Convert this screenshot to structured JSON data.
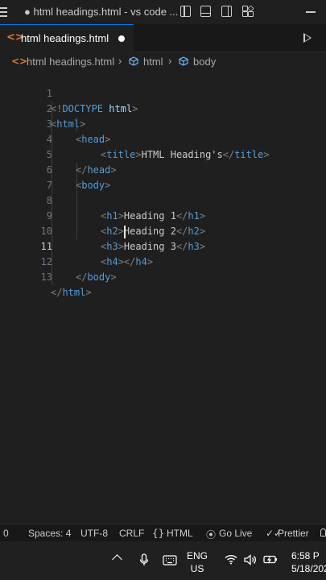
{
  "window": {
    "title": "● html headings.html - vs code ..."
  },
  "tab": {
    "label": "html headings.html",
    "modified": true,
    "icon": "html-file-icon"
  },
  "breadcrumb": {
    "file": "html headings.html",
    "items": [
      "html",
      "body"
    ]
  },
  "editor": {
    "active_line": 11,
    "lines": [
      {
        "n": "1"
      },
      {
        "n": "2"
      },
      {
        "n": "3"
      },
      {
        "n": "4"
      },
      {
        "n": "5"
      },
      {
        "n": "6"
      },
      {
        "n": "7"
      },
      {
        "n": "8"
      },
      {
        "n": "9"
      },
      {
        "n": "10"
      },
      {
        "n": "11"
      },
      {
        "n": "12"
      },
      {
        "n": "13"
      }
    ],
    "code": {
      "doctype_open": "<!",
      "doctype_kw": "DOCTYPE",
      "doctype_val": "html",
      "doctype_close": ">",
      "html": "html",
      "head": "head",
      "title": "title",
      "title_text": "HTML Heading's",
      "body": "body",
      "h1": "h1",
      "h1_text": "Heading 1",
      "h2": "h2",
      "h2_text": "Heading 2",
      "h3": "h3",
      "h3_text": "Heading 3",
      "h4": "h4",
      "lt": "<",
      "gt": ">",
      "lts": "</"
    }
  },
  "statusbar": {
    "position": "0",
    "spaces": "Spaces: 4",
    "encoding": "UTF-8",
    "eol": "CRLF",
    "language": "HTML",
    "golive": "Go Live",
    "prettier": "Prettier"
  },
  "taskbar": {
    "lang_line1": "ENG",
    "lang_line2": "US",
    "time": "6:58 P",
    "date": "5/18/202"
  },
  "colors": {
    "background": "#1f1f1f",
    "tag": "#569cd6",
    "bracket": "#808080",
    "text": "#cccccc",
    "accent": "#0078d4",
    "html_icon": "#e37933"
  }
}
